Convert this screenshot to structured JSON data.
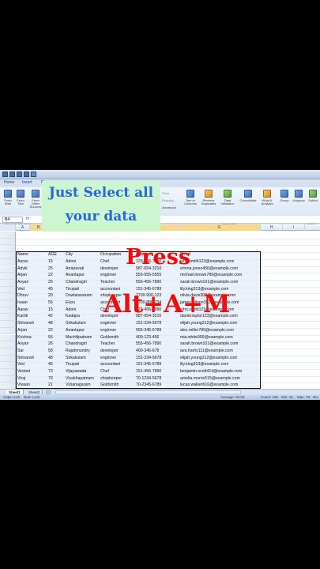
{
  "quick_access": {
    "icons": [
      "save-icon",
      "undo-icon",
      "redo-icon",
      "print-icon",
      "dropdown-icon"
    ]
  },
  "tabs": [
    {
      "label": "Home"
    },
    {
      "label": "Insert"
    },
    {
      "label": "P"
    }
  ],
  "ribbon": {
    "buttons_left": [
      {
        "label": "From Web"
      },
      {
        "label": "From Text"
      },
      {
        "label": "From Other Sources"
      }
    ],
    "group_left": "Get External Data",
    "advanced_label": "Advanced",
    "buttons_right": [
      {
        "label": "Text to Columns"
      },
      {
        "label": "Remove Duplicates"
      },
      {
        "label": "Data Validation"
      },
      {
        "label": "Consolidate"
      },
      {
        "label": "What-If Analysis"
      },
      {
        "label": "Group"
      },
      {
        "label": "Ungroup"
      },
      {
        "label": "Subtot"
      }
    ],
    "group_data_tools": "Data Tools",
    "group_outline": "Outline",
    "clear_label": "Clear",
    "reapply_label": "Reapply"
  },
  "overlay_caption": {
    "line1": "Just Select all",
    "line2": "your data"
  },
  "overlay_press": {
    "line1": "Press",
    "line2": "Alt+A+M"
  },
  "formula_bar": {
    "name_box": "B4",
    "fx": "fx"
  },
  "columns": [
    "A",
    "B",
    "C",
    "D",
    "E",
    "F",
    "G",
    "H",
    "I"
  ],
  "headers": {
    "name": "Name",
    "age": "AGE",
    "city": "City",
    "occupation": "Occupation",
    "contact": "Contact",
    "email": "Email"
  },
  "rows": [
    {
      "name": "Aarav",
      "age": "15",
      "city": "Adoni",
      "occ": "Chef",
      "contact": "123-456-7890",
      "email": "john.smith123@example.com"
    },
    {
      "name": "Advik",
      "age": "25",
      "city": "Amaravati",
      "occ": "developer",
      "contact": "987-654-3210",
      "email": "emma.jones456@example.com"
    },
    {
      "name": "Arjan",
      "age": "22",
      "city": "Anantapur",
      "occ": "enginner",
      "contact": "555-555-5555",
      "email": "michael.brown789@example.com"
    },
    {
      "name": "Avyan",
      "age": "26",
      "city": "Chandragiri",
      "occ": "Teacher",
      "contact": "555-456-7890",
      "email": "sarah.brown101@example.com"
    },
    {
      "name": "Ved",
      "age": "45",
      "city": "Tirupati",
      "occ": "accountant",
      "contact": "151-345-6789",
      "email": "lily.king313@example.com"
    },
    {
      "name": "Dhruv",
      "age": "20",
      "city": "Dowlaiswaram",
      "occ": "shopkeeper",
      "contact": "7700-900-123",
      "email": "olivia.davis303@example.com"
    },
    {
      "name": "Ivaan",
      "age": "56",
      "city": "Eluru",
      "occ": "accountant",
      "contact": "7700-800-234",
      "email": "james.wilson321@example.com"
    },
    {
      "name": "Aarav",
      "age": "15",
      "city": "Adoni",
      "occ": "Chef",
      "contact": "123-456-7890",
      "email": "john.smith123@example.com"
    },
    {
      "name": "Kartik",
      "age": "42",
      "city": "Kadapa",
      "occ": "developer",
      "contact": "987-654-3210",
      "email": "daniel.taylor123@example.com"
    },
    {
      "name": "Shivansh",
      "age": "48",
      "city": "Srikakulam",
      "occ": "enginner",
      "contact": "151-234-5678",
      "email": "elijah.young212@example.com"
    },
    {
      "name": "Arjan",
      "age": "22",
      "city": "Anantapur",
      "occ": "enginner",
      "contact": "555-345-6789",
      "email": "alex.miller789@example.com"
    },
    {
      "name": "Krishna",
      "age": "55",
      "city": "Machilipatnam",
      "occ": "Goldsmith",
      "contact": "400-123-456",
      "email": "mia.white909@example.com"
    },
    {
      "name": "Avyan",
      "age": "26",
      "city": "Chandragiri",
      "occ": "Teacher",
      "contact": "555-456-7890",
      "email": "sarah.brown101@example.com"
    },
    {
      "name": "Sai",
      "age": "58",
      "city": "Rajahmundry",
      "occ": "developer",
      "contact": "400-345-678",
      "email": "ava.harris111@example.com"
    },
    {
      "name": "Shivansh",
      "age": "48",
      "city": "Srikakulam",
      "occ": "enginner",
      "contact": "151-234-5678",
      "email": "elijah.young212@example.com"
    },
    {
      "name": "Ved",
      "age": "45",
      "city": "Tirupati",
      "occ": "accountant",
      "contact": "151-345-6789",
      "email": "lily.king313@example.com"
    },
    {
      "name": "Vedant",
      "age": "73",
      "city": "Vijayawada",
      "occ": "Chef",
      "contact": "151-456-7890",
      "email": "benjamin.scott414@example.com"
    },
    {
      "name": "Viraj",
      "age": "79",
      "city": "Visakhapatnam",
      "occ": "shopkeeper",
      "contact": "70-1234-5678",
      "email": "amelia.morris515@example.com"
    },
    {
      "name": "Vivaan",
      "age": "21",
      "city": "Vizianagaram",
      "occ": "Goldsmith",
      "contact": "70-2345-6789",
      "email": "lucas.walker616@example.com"
    },
    {
      "name": "Sai",
      "age": "58",
      "city": "Rajahmundry",
      "occ": "developer",
      "contact": "400-345-678",
      "email": "ava.harris111@example.com"
    }
  ],
  "sheets": [
    {
      "label": "Sheet1"
    },
    {
      "label": "Sheet2"
    }
  ],
  "status": {
    "caps": "Caps Lock",
    "num": "Num Lock",
    "average": "Average: 39.55",
    "count": "Count: 166",
    "min": "Min: 15",
    "max": "Max: 79",
    "zoom": "5%"
  },
  "colors": {
    "overlay_green": "#ccf7cf",
    "overlay_text_blue": "#1f5fd8",
    "press_red": "#ee0c0c",
    "selection": "#ebf1fa"
  }
}
